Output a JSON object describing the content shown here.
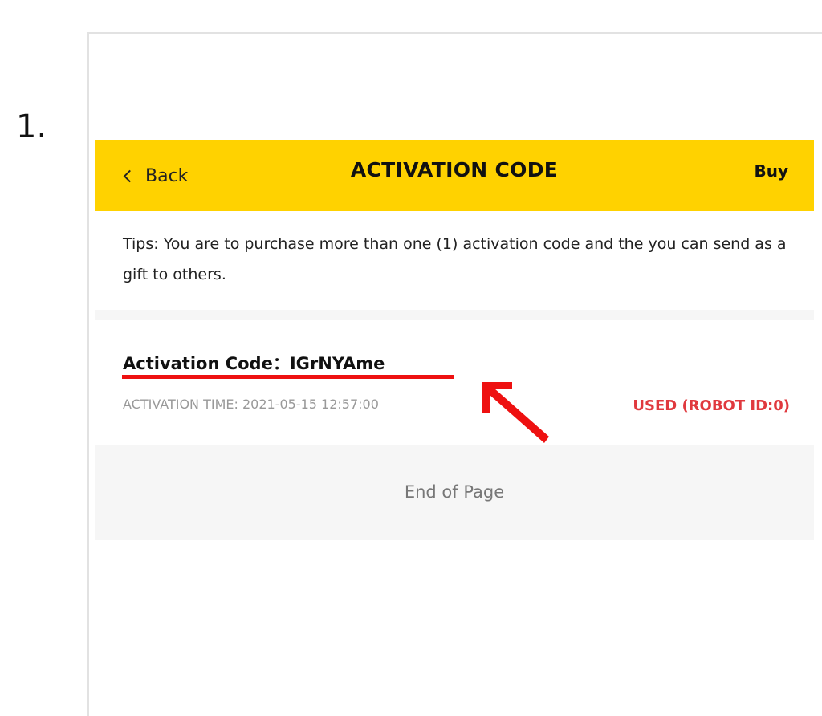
{
  "step": {
    "number": "1."
  },
  "header": {
    "back_label": "Back",
    "title": "ACTIVATION CODE",
    "buy_label": "Buy",
    "background_color": "#ffd200"
  },
  "tips": {
    "text": "Tips: You are to purchase more than one (1) activation code and the you can send as a gift to others."
  },
  "code_item": {
    "code_label": "Activation Code：",
    "code_value": "IGrNYAme",
    "activation_time": "ACTIVATION TIME: 2021-05-15 12:57:00",
    "status": "USED (ROBOT ID:0)",
    "status_color": "#e0393e"
  },
  "footer": {
    "end_text": "End of Page"
  },
  "annotations": {
    "underline_color": "#ee1111",
    "arrow_icon": "red-arrow-pointing-up-left-icon"
  }
}
